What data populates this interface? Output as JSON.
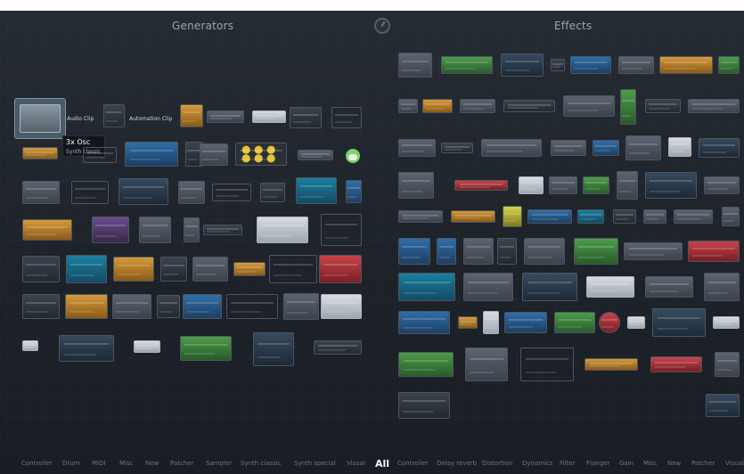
{
  "sections": {
    "generators_title": "Generators",
    "effects_title": "Effects"
  },
  "generators": {
    "featured": [
      {
        "label": "Audio Clip",
        "icon": "audio-clip-icon"
      },
      {
        "label": "Automation Clip",
        "icon": "automation-clip-icon"
      }
    ],
    "tooltip": {
      "title": "3x Osc",
      "subtitle": "Synth classic"
    }
  },
  "bottom_nav": {
    "generators_filters": [
      "Controller",
      "Drum",
      "MIDI",
      "Misc",
      "New",
      "Patcher",
      "Sampler",
      "Synth classic",
      "Synth special",
      "Visual"
    ],
    "all_label": "All",
    "effects_filters": [
      "Controller",
      "Delay reverb",
      "Distortion",
      "Dynamics",
      "Filter",
      "Flanger",
      "Gain",
      "Misc",
      "New",
      "Patcher",
      "Visual"
    ]
  },
  "colors": {
    "background": "#20262d",
    "accent_text": "#f2f5f8",
    "muted_text": "#6b747e"
  }
}
